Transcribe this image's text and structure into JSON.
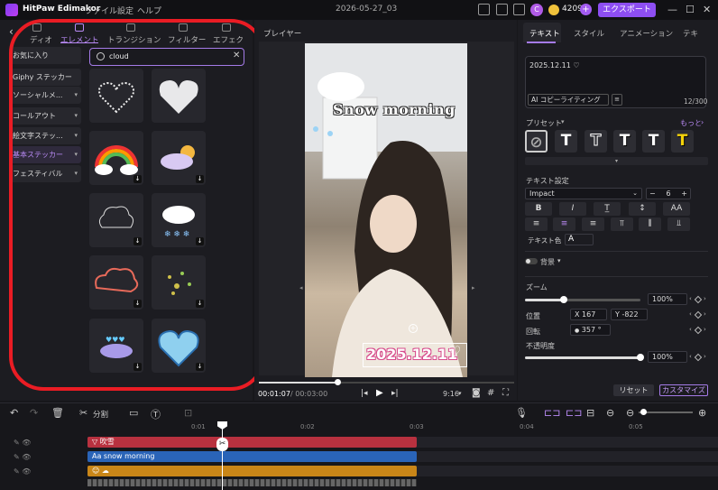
{
  "app": {
    "name": "HitPaw Edimakor",
    "menus": [
      "ファイル",
      "設定",
      "ヘルプ"
    ],
    "project": "2026-05-27_03",
    "avatar": "C",
    "coins": "4209",
    "export_label": "エクスポート"
  },
  "left": {
    "tabs": [
      "ディオ",
      "エレメント",
      "トランジション",
      "フィルター",
      "エフェク"
    ],
    "categories": [
      "お気に入り",
      "Giphy ステッカー",
      "ソーシャルメ...",
      "コールアウト",
      "絵文字ステッ...",
      "基本ステッカー",
      "フェスティバル"
    ],
    "search_value": "cloud"
  },
  "player": {
    "title": "プレイヤー",
    "snow_text": "Snow morning",
    "date_text": "2025.12.11",
    "current_time": "00:01:07",
    "total_time": "/ 00:03:00",
    "ratio": "9:16"
  },
  "right": {
    "tabs": [
      "テキスト",
      "スタイル",
      "アニメーション",
      "テキ"
    ],
    "text_value": "2025.12.11 ♡",
    "ai_label": "AI コピーライティング",
    "char_count": "12/300",
    "preset_label": "プリセット",
    "more_label": "もっと",
    "text_settings_label": "テキスト設定",
    "font": "Impact",
    "font_size": "6",
    "case_label": "AA",
    "text_color_label": "テキスト色",
    "background_label": "背景",
    "zoom_label": "ズーム",
    "zoom_value": "100%",
    "position_label": "位置",
    "pos_x_label": "X",
    "pos_x": "167",
    "pos_y_label": "Y",
    "pos_y": "-822",
    "rotation_label": "回転",
    "rotation_value": "357 °",
    "opacity_label": "不透明度",
    "opacity_value": "100%",
    "reset_label": "リセット",
    "customize_label": "カスタマイズ"
  },
  "timeline": {
    "split_label": "分割",
    "ruler": [
      "0:01",
      "0:02",
      "0:03",
      "0:04",
      "0:05"
    ],
    "tracks": [
      {
        "label": "吹雪",
        "color": "#b8313f"
      },
      {
        "label": "snow morning",
        "color": "#2a64b8"
      },
      {
        "label": "☁",
        "color": "#c98618"
      }
    ]
  },
  "colors": {
    "accent": "#8d4ef2",
    "highlight": "#ea1c24"
  }
}
